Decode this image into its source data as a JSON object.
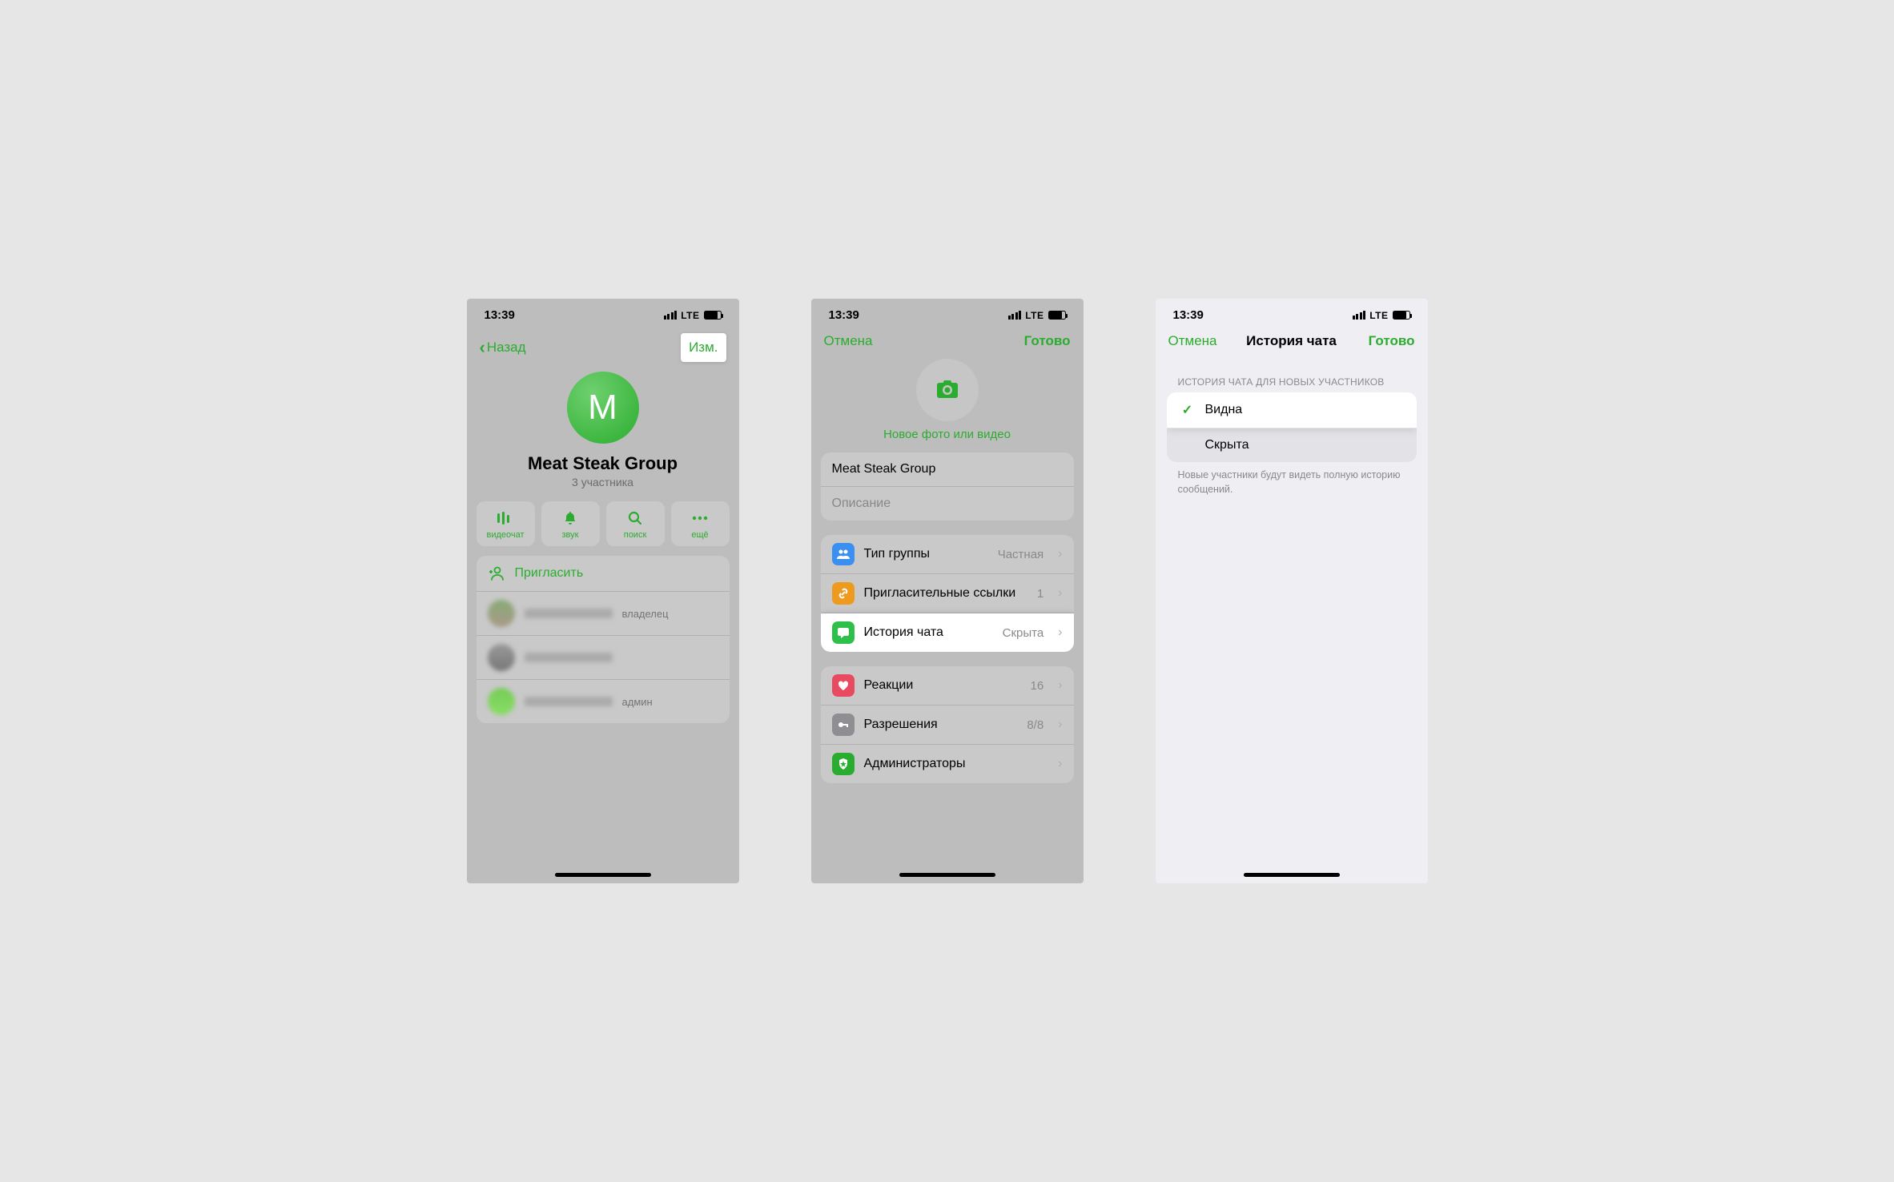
{
  "status": {
    "time": "13:39",
    "network": "LTE"
  },
  "screen1": {
    "nav": {
      "back": "Назад",
      "edit": "Изм."
    },
    "avatar_letter": "M",
    "group_name": "Meat Steak Group",
    "members_count": "3 участника",
    "actions": {
      "videochat": "видеочат",
      "sound": "звук",
      "search": "поиск",
      "more": "ещё"
    },
    "invite": "Пригласить",
    "member_roles": {
      "owner": "владелец",
      "admin": "админ"
    }
  },
  "screen2": {
    "nav": {
      "cancel": "Отмена",
      "done": "Готово"
    },
    "new_photo": "Новое фото или видео",
    "fields": {
      "name": "Meat Steak Group",
      "description_placeholder": "Описание"
    },
    "rows": {
      "group_type": {
        "label": "Тип группы",
        "value": "Частная"
      },
      "invite_links": {
        "label": "Пригласительные ссылки",
        "value": "1"
      },
      "chat_history": {
        "label": "История чата",
        "value": "Скрыта"
      },
      "reactions": {
        "label": "Реакции",
        "value": "16"
      },
      "permissions": {
        "label": "Разрешения",
        "value": "8/8"
      },
      "admins": {
        "label": "Администраторы",
        "value": ""
      }
    }
  },
  "screen3": {
    "nav": {
      "cancel": "Отмена",
      "title": "История чата",
      "done": "Готово"
    },
    "section_header": "ИСТОРИЯ ЧАТА ДЛЯ НОВЫХ УЧАСТНИКОВ",
    "options": {
      "visible": "Видна",
      "hidden": "Скрыта"
    },
    "footer": "Новые участники будут видеть полную историю сообщений."
  }
}
